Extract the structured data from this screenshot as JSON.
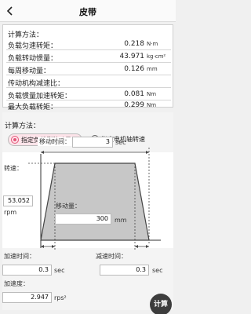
{
  "header": {
    "title": "皮带"
  },
  "results": {
    "section_label": "计算方法：",
    "rows": [
      {
        "label": "负载匀速转矩：",
        "value": "0.218",
        "unit": "N·m"
      },
      {
        "label": "负载转动惯量：",
        "value": "43.971",
        "unit": "kg·cm²"
      },
      {
        "label": "每周移动量：",
        "value": "0.126",
        "unit": "mm"
      },
      {
        "label": "传动机构减速比：",
        "value": "",
        "unit": ""
      },
      {
        "label": "负载惯量加速转矩：",
        "value": "0.081",
        "unit": "Nm"
      },
      {
        "label": "最大负载转矩：",
        "value": "0.299",
        "unit": "Nm"
      }
    ]
  },
  "method": {
    "section_label": "计算方法：",
    "options": [
      {
        "label": "指定负载侧移动量",
        "selected": true
      },
      {
        "label": "指定电机轴转速",
        "selected": false
      }
    ]
  },
  "profile": {
    "move_time_label": "移动时间：",
    "move_time_value": "3",
    "move_time_unit": "sec",
    "speed_label": "转速：",
    "speed_value": "53.052",
    "speed_unit": "rpm",
    "move_amount_label": "移动量：",
    "move_amount_value": "300",
    "move_amount_unit": "mm",
    "accel_time_label": "加速时间：",
    "accel_time_value": "0.3",
    "accel_time_unit": "sec",
    "decel_time_label": "减速时间：",
    "decel_time_value": "0.3",
    "decel_time_unit": "sec",
    "acceleration_label": "加速度：",
    "acceleration_value": "2.947",
    "acceleration_unit": "rps²"
  },
  "actions": {
    "calculate_label": "计算"
  }
}
